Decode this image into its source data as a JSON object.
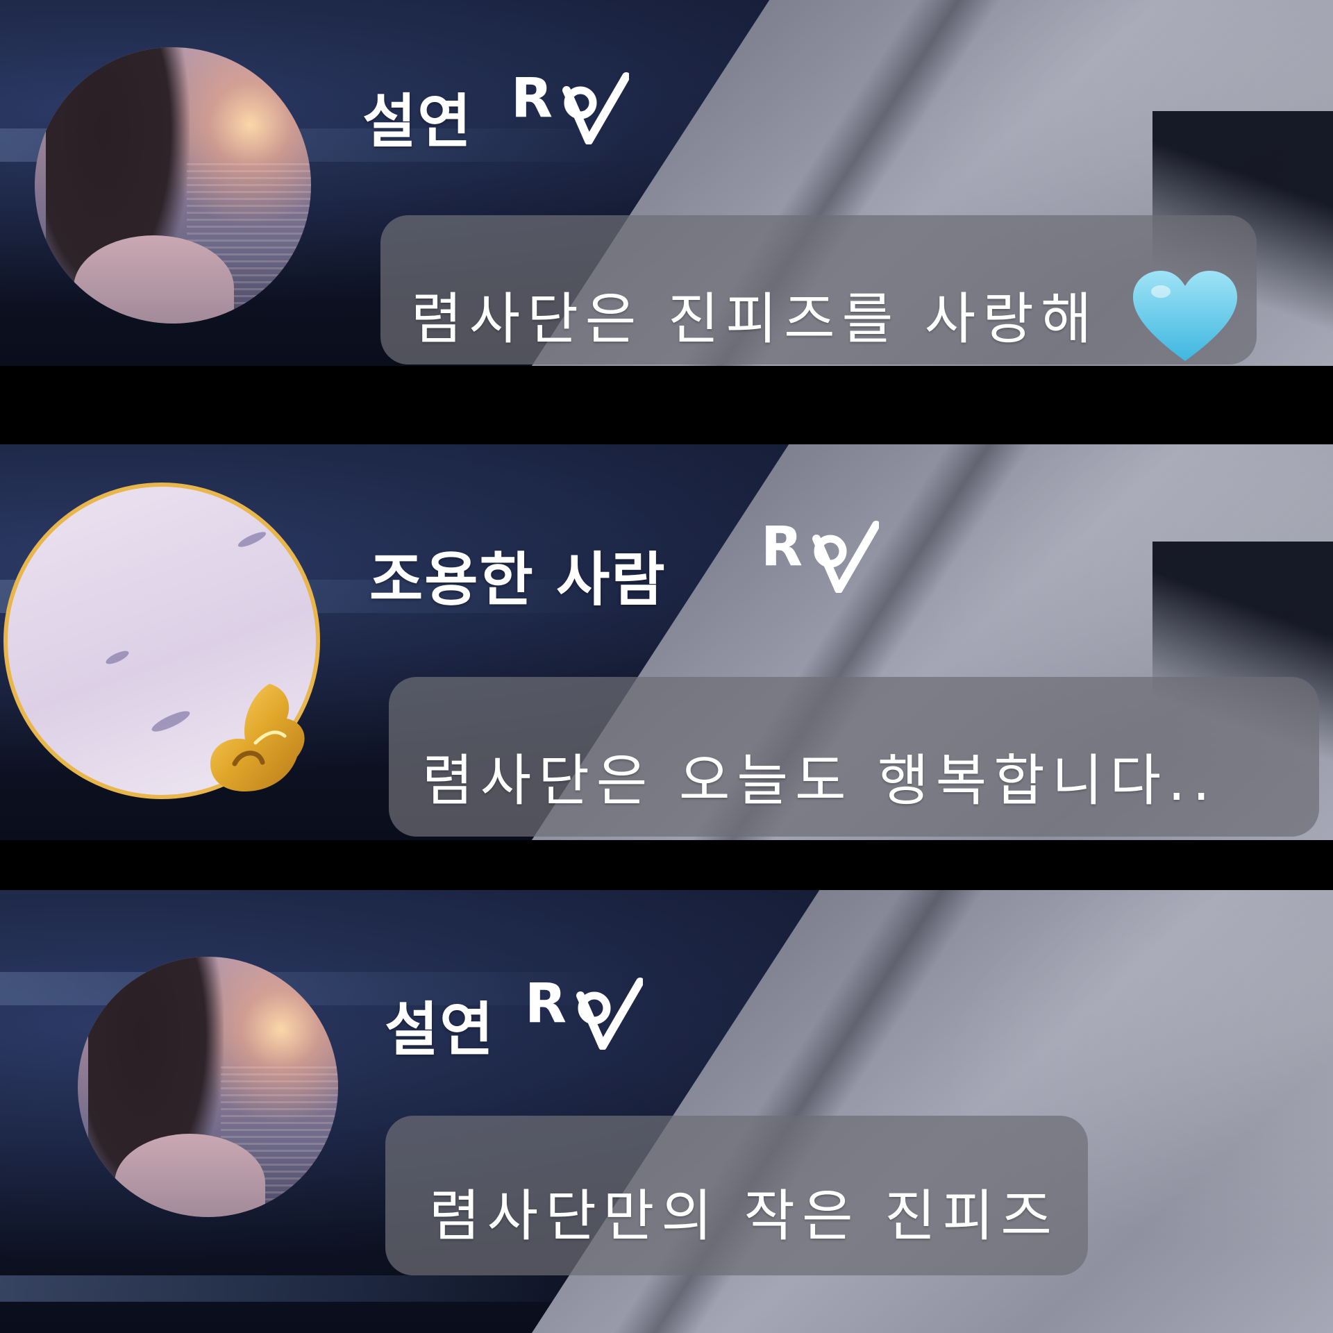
{
  "messages": [
    {
      "sender": "설연",
      "role_tag": "R",
      "text": "렴사단은 진피즈를 사랑해",
      "emoji": "light-blue-heart",
      "avatar": "sunset-girl-avatar"
    },
    {
      "sender": "조용한 사람",
      "role_tag": "R",
      "text": "렴사단은 오늘도 행복합니다..",
      "avatar": "lilac-sky-avatar",
      "avatar_frame_color": "#e8b64a"
    },
    {
      "sender": "설연",
      "role_tag": "R",
      "text": "렴사단만의 작은 진피즈",
      "avatar": "sunset-girl-avatar"
    }
  ],
  "colors": {
    "bubble": "#6e6e76",
    "heart": "#6fd0ec",
    "badge_gold": "#e0a62a",
    "text": "#ffffff"
  }
}
